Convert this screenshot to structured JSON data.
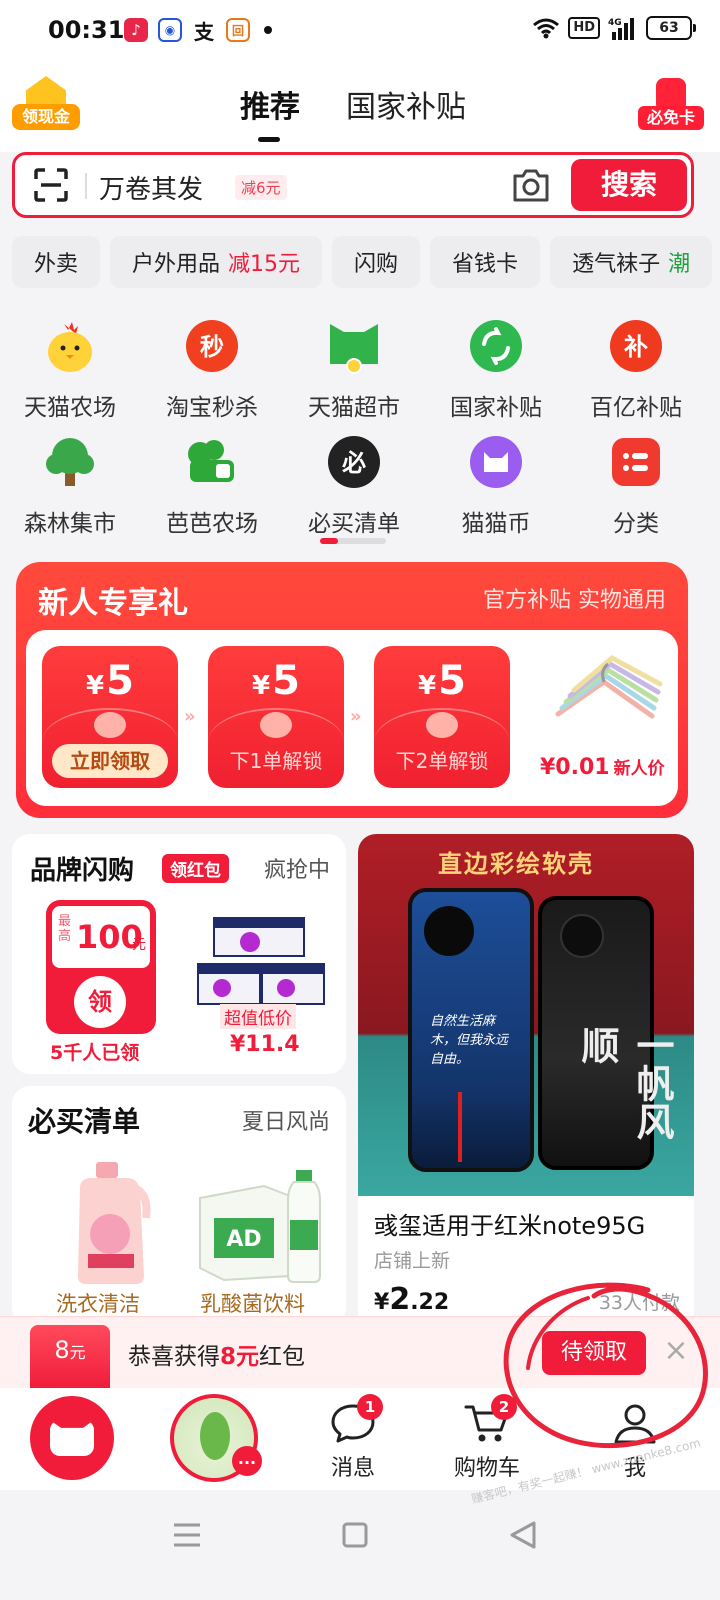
{
  "status_bar": {
    "time": "00:31",
    "apps": [
      "music-app-icon",
      "baidu-icon",
      "alipay-icon",
      "wallet-icon"
    ],
    "hd_label": "HD",
    "network_label": "4G",
    "battery": "63"
  },
  "header": {
    "left_badge": "领现金",
    "tabs": [
      {
        "label": "推荐",
        "active": true
      },
      {
        "label": "国家补贴",
        "active": false
      }
    ],
    "right_badge": "必免卡"
  },
  "search": {
    "query": "万卷其发",
    "discount": "减6元",
    "button": "搜索"
  },
  "chips": [
    {
      "label": "外卖",
      "highlight": ""
    },
    {
      "label": "户外用品",
      "highlight": "减15元"
    },
    {
      "label": "闪购",
      "highlight": ""
    },
    {
      "label": "省钱卡",
      "highlight": ""
    },
    {
      "label": "透气袜子",
      "highlight": "潮"
    }
  ],
  "grid": [
    {
      "label": "天猫农场",
      "icon": "chick-icon"
    },
    {
      "label": "淘宝秒杀",
      "icon": "flash-sale-icon"
    },
    {
      "label": "天猫超市",
      "icon": "supermarket-icon"
    },
    {
      "label": "国家补贴",
      "icon": "subsidy-icon"
    },
    {
      "label": "百亿补贴",
      "icon": "billion-subsidy-icon"
    },
    {
      "label": "森林集市",
      "icon": "tree-icon"
    },
    {
      "label": "芭芭农场",
      "icon": "farm-icon"
    },
    {
      "label": "必买清单",
      "icon": "must-buy-icon"
    },
    {
      "label": "猫猫币",
      "icon": "cat-coin-icon"
    },
    {
      "label": "分类",
      "icon": "category-icon"
    }
  ],
  "new_user": {
    "title": "新人专享礼",
    "subtitle": "官方补贴 实物通用",
    "envelopes": [
      {
        "currency": "¥",
        "amount": "5",
        "cta": "立即领取"
      },
      {
        "currency": "¥",
        "amount": "5",
        "cta": "下1单解锁"
      },
      {
        "currency": "¥",
        "amount": "5",
        "cta": "下2单解锁"
      }
    ],
    "product_price": "¥0.01",
    "product_price_label": "新人价"
  },
  "brand_flash": {
    "title": "品牌闪购",
    "tag": "领红包",
    "status": "疯抢中",
    "coupon_prefix": "最高",
    "coupon_amount": "100",
    "coupon_unit": "元",
    "coupon_button": "领",
    "claimed": "5千人已领",
    "product_tag": "超值低价",
    "product_price": "¥11.4"
  },
  "must_buy": {
    "title": "必买清单",
    "subtitle": "夏日风尚",
    "items": [
      {
        "label": "洗衣清洁"
      },
      {
        "label": "乳酸菌饮料"
      }
    ]
  },
  "product": {
    "banner": "直边彩绘软壳",
    "phone1_text": "自然生活麻木，但我永远自由。",
    "phone2_text": "一帆风顺",
    "title": "彧玺适用于红米note95G",
    "subtitle": "店铺上新",
    "price_currency": "¥",
    "price_int": "2",
    "price_dec": ".22",
    "sold": "33人付款"
  },
  "coupon_bar": {
    "badge_amount": "8",
    "badge_unit": "元",
    "text_prefix": "恭喜获得",
    "text_amount": "8元",
    "text_suffix": "红包",
    "button": "待领取",
    "close": "×"
  },
  "tabbar": {
    "messages_label": "消息",
    "messages_badge": "1",
    "cart_label": "购物车",
    "cart_badge": "2",
    "me_label": "我",
    "avatar_badge": "..."
  },
  "watermark": "赚客吧，有奖一起赚！ www.zuanke8.com",
  "colors": {
    "brand_red": "#f01c3a",
    "annotation_red": "#e8243a"
  }
}
